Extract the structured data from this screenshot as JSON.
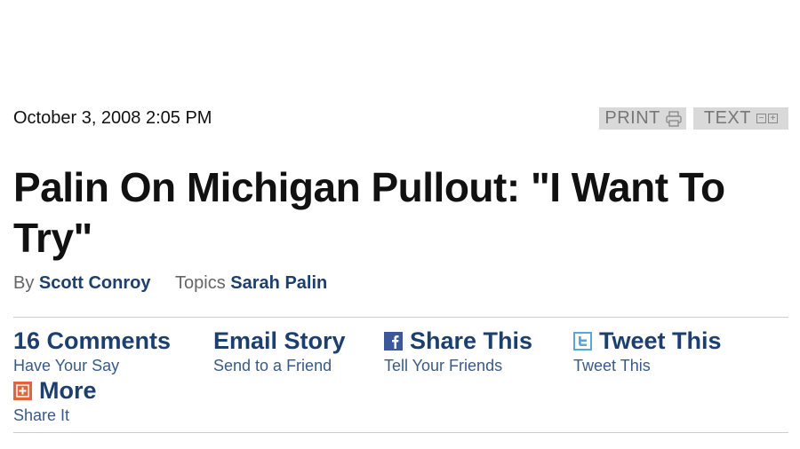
{
  "article": {
    "date": "October 3, 2008 2:05 PM",
    "headline": "Palin On Michigan Pullout: \"I Want To Try\"",
    "byline": {
      "by_label": "By",
      "author": "Scott Conroy",
      "topics_label": "Topics",
      "topic": "Sarah Palin"
    }
  },
  "tools": {
    "print_label": "PRINT",
    "text_label": "TEXT",
    "text_minus": "−",
    "text_plus": "+"
  },
  "actions": {
    "comments": {
      "title": "16 Comments",
      "sub": "Have Your Say"
    },
    "email": {
      "title": "Email Story",
      "sub": "Send to a Friend"
    },
    "share": {
      "title": "Share This",
      "sub": "Tell Your Friends",
      "icon": "facebook-icon"
    },
    "tweet": {
      "title": "Tweet This",
      "sub": "Tweet This",
      "icon": "twitter-icon"
    },
    "more": {
      "title": "More",
      "sub": "Share It",
      "icon": "plus-icon"
    }
  },
  "colors": {
    "link": "#1d3f6e",
    "facebook": "#3b5998",
    "twitter": "#5aa6d6",
    "plus": "#e2643c"
  }
}
